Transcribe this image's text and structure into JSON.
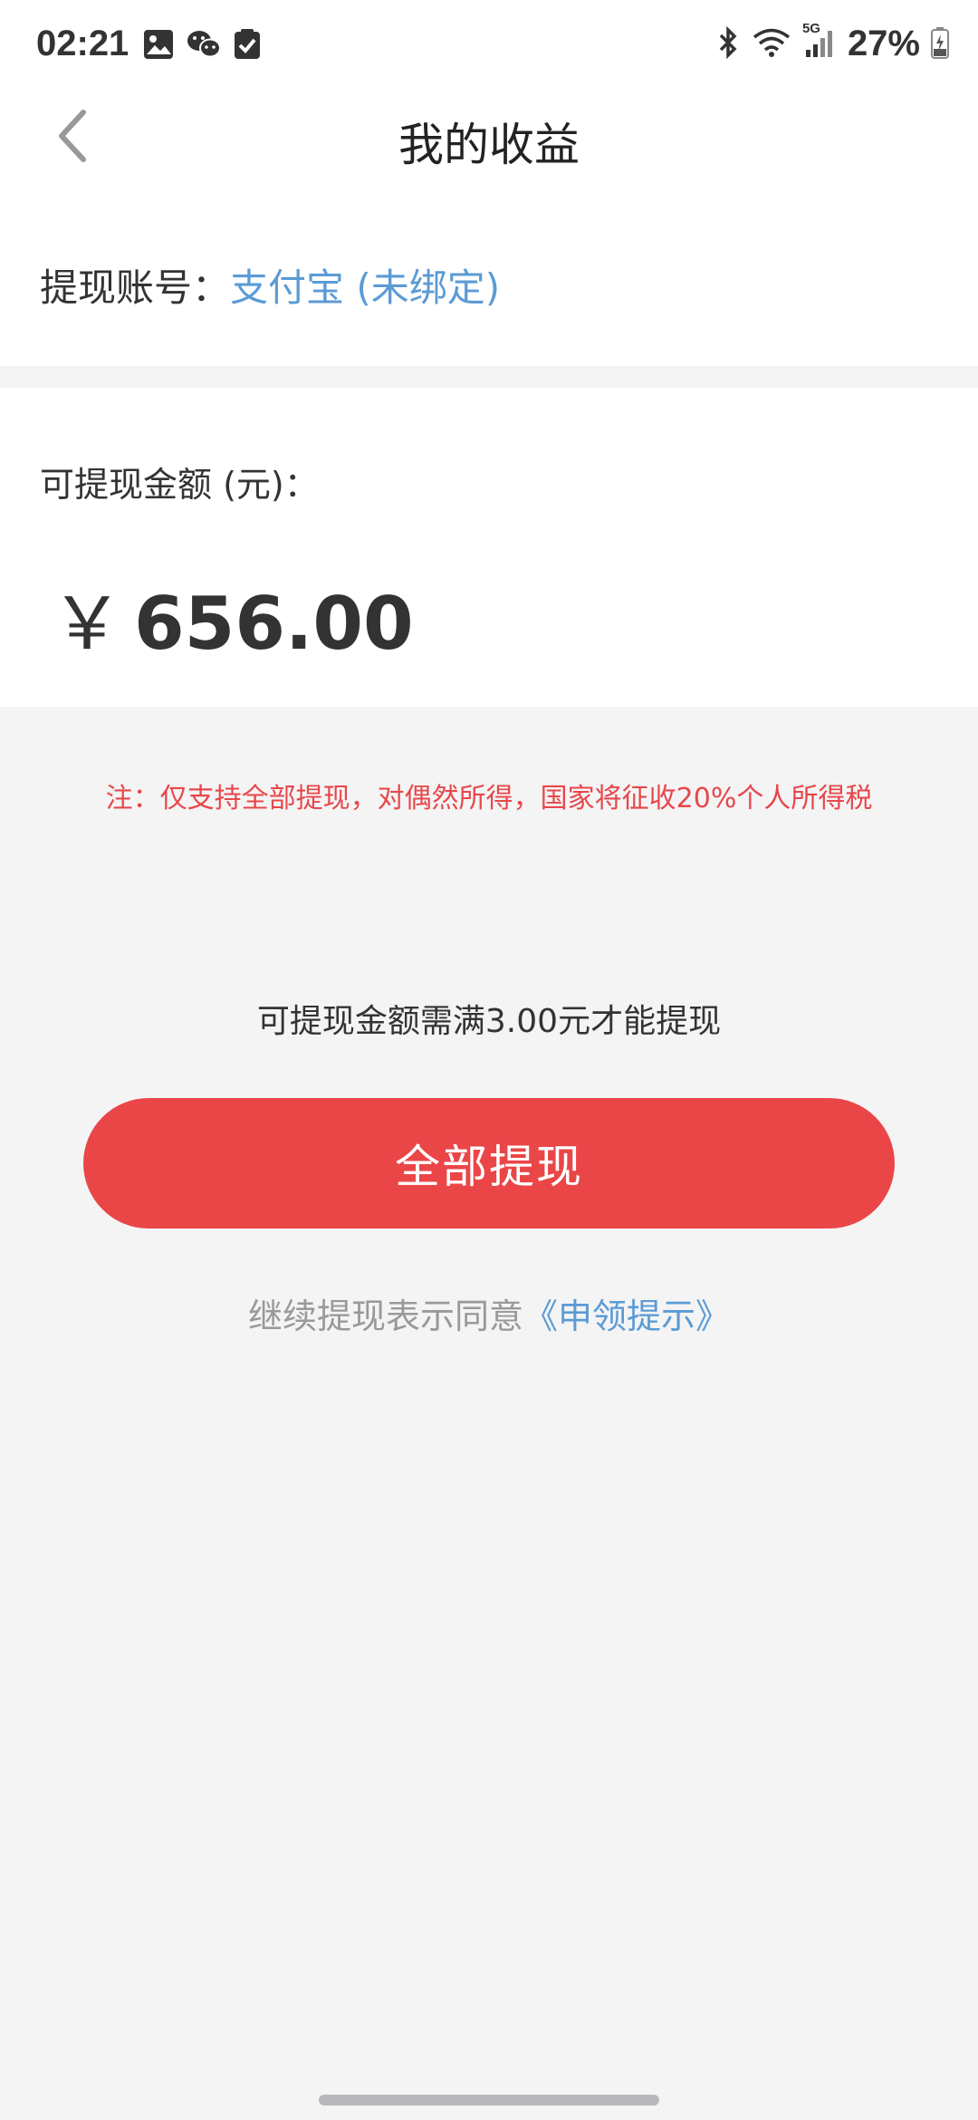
{
  "status_bar": {
    "time": "02:21",
    "battery": "27%",
    "network": "5G",
    "left_icons": [
      "image-icon",
      "wechat-icon",
      "checkbox-icon"
    ],
    "right_icons": [
      "bluetooth-icon",
      "wifi-icon",
      "signal-icon",
      "battery-icon"
    ]
  },
  "header": {
    "title": "我的收益"
  },
  "account": {
    "label": "提现账号：",
    "value": "支付宝 (未绑定)"
  },
  "amount": {
    "label": "可提现金额 (元)：",
    "currency": "￥",
    "value": "656.00"
  },
  "note": "注：仅支持全部提现，对偶然所得，国家将征收20%个人所得税",
  "min_hint": "可提现金额需满3.00元才能提现",
  "withdraw_button": "全部提现",
  "agreement": {
    "text": "继续提现表示同意",
    "link": "《申领提示》"
  },
  "colors": {
    "accent_red": "#ea4648",
    "link_blue": "#5b9bd5",
    "note_red": "#e8474a",
    "background": "#f4f4f5"
  }
}
